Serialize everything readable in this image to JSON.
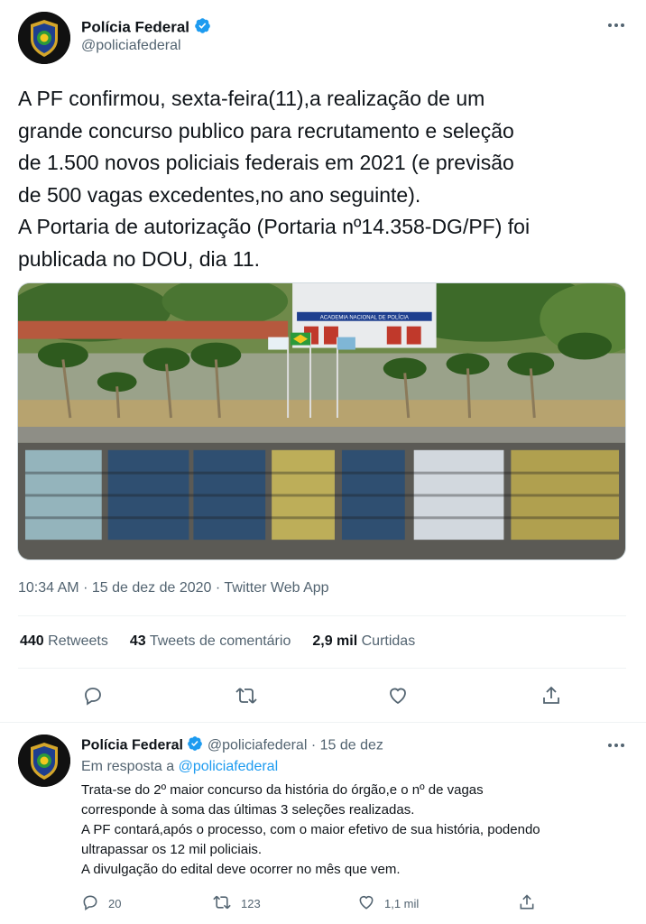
{
  "tweet": {
    "author_name": "Polícia Federal",
    "author_handle": "@policiafederal",
    "text": "A PF confirmou, sexta-feira(11),a realização de um\ngrande concurso publico para recrutamento e seleção\nde 1.500 novos policiais federais em 2021 (e previsão\nde 500 vagas excedentes,no ano seguinte).\nA Portaria de autorização (Portaria nº14.358-DG/PF) foi\npublicada no DOU, dia 11.",
    "image_sign_text": "ACADEMIA NACIONAL DE POLÍCIA",
    "time": "10:34 AM",
    "date": "15 de dez de 2020",
    "source": "Twitter Web App",
    "stats": {
      "retweets_count": "440",
      "retweets_label": "Retweets",
      "quotes_count": "43",
      "quotes_label": "Tweets de comentário",
      "likes_count": "2,9 mil",
      "likes_label": "Curtidas"
    }
  },
  "reply": {
    "author_name": "Polícia Federal",
    "author_handle": "@policiafederal",
    "date": "15 de dez",
    "in_reply_prefix": "Em resposta a",
    "in_reply_handle": "@policiafederal",
    "text": "Trata-se do 2º maior concurso da história do órgão,e o nº de vagas\ncorresponde à soma das últimas 3 seleções realizadas.\nA PF contará,após o processo, com o maior efetivo de sua história, podendo\nultrapassar os 12 mil policiais.\nA divulgação do edital deve ocorrer no mês que vem.",
    "replies": "20",
    "retweets": "123",
    "likes": "1,1 mil"
  },
  "colors": {
    "accent": "#1d9bf0",
    "text": "#0f1419",
    "muted": "#536471"
  },
  "icons": [
    "verified-badge-icon",
    "more-icon",
    "reply-icon",
    "retweet-icon",
    "like-icon",
    "share-icon"
  ]
}
